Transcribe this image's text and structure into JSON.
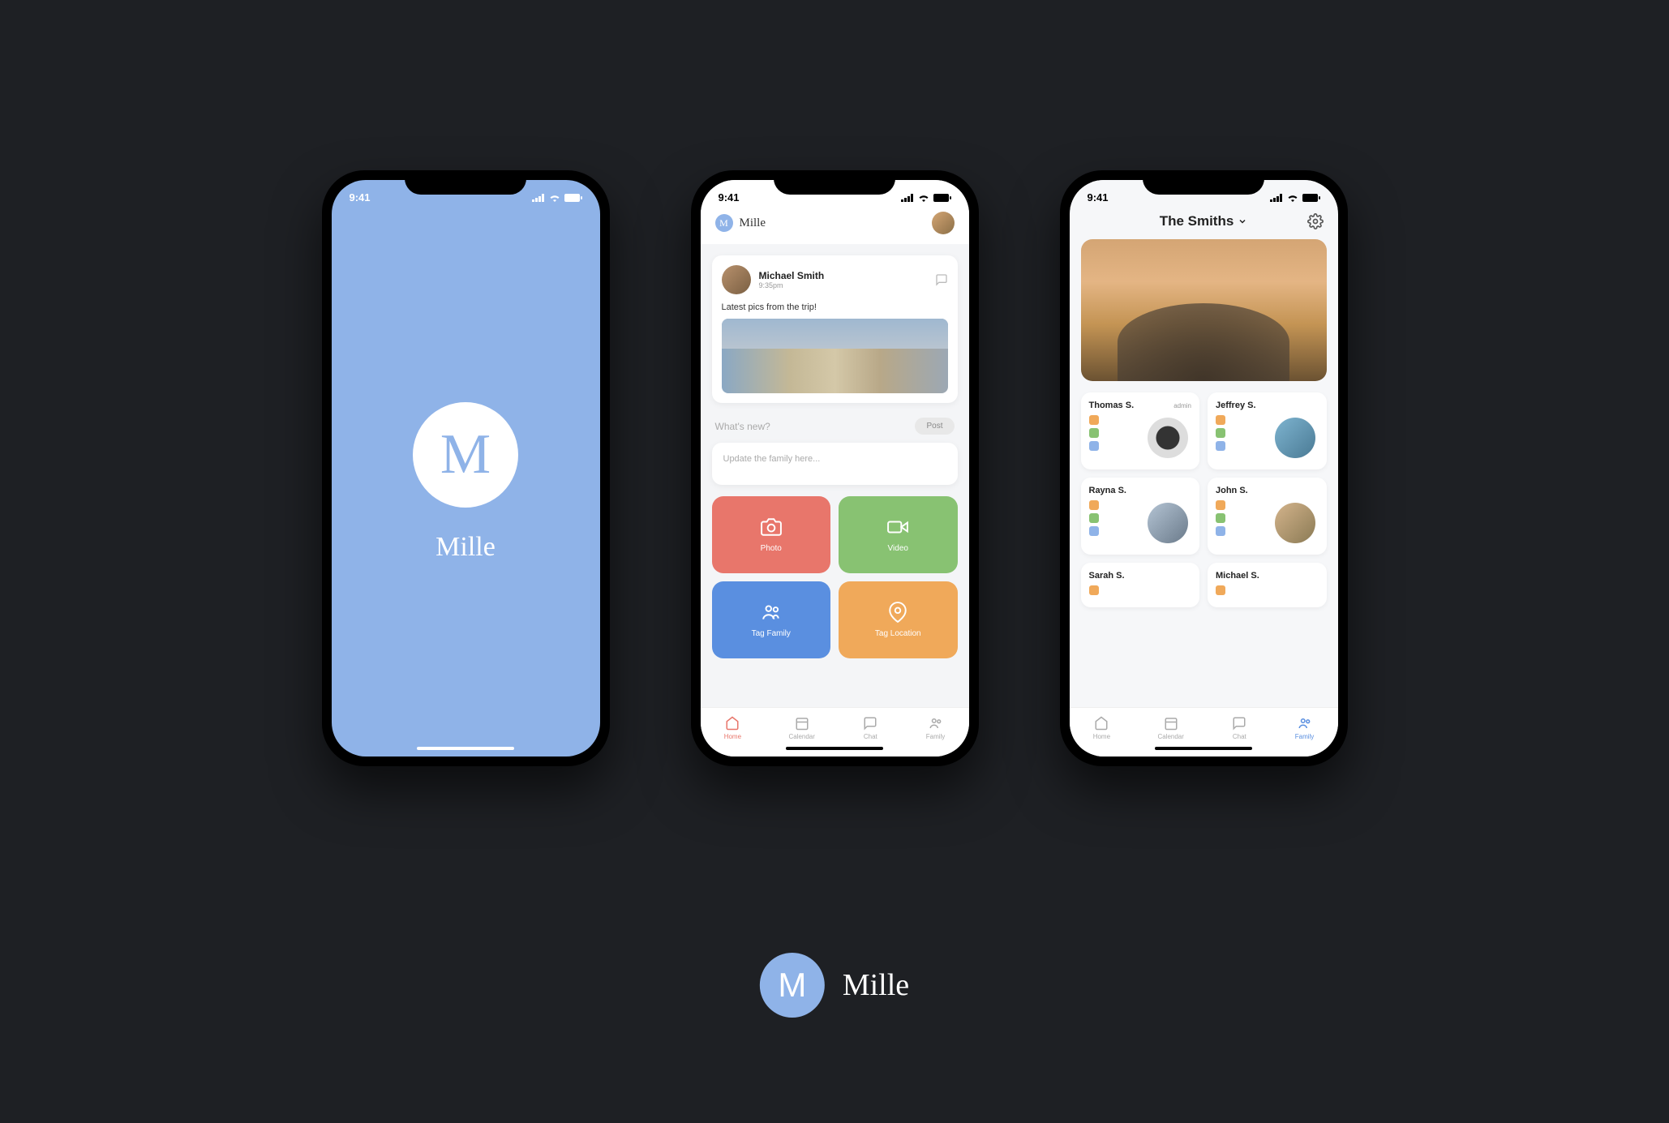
{
  "status_time": "9:41",
  "splash": {
    "logo_letter": "M",
    "title": "Mille"
  },
  "feed": {
    "header_title": "Mille",
    "post": {
      "author": "Michael Smith",
      "time": "9:35pm",
      "text": "Latest pics from the trip!"
    },
    "compose_prompt": "What's new?",
    "post_button": "Post",
    "compose_placeholder": "Update the family here...",
    "tiles": {
      "photo": "Photo",
      "video": "Video",
      "tag_family": "Tag Family",
      "tag_location": "Tag Location"
    },
    "tabs": {
      "home": "Home",
      "calendar": "Calendar",
      "chat": "Chat",
      "family": "Family"
    }
  },
  "family": {
    "title": "The Smiths",
    "members": [
      {
        "name": "Thomas S.",
        "badge": "admin"
      },
      {
        "name": "Jeffrey S."
      },
      {
        "name": "Rayna S."
      },
      {
        "name": "John S."
      },
      {
        "name": "Sarah S."
      },
      {
        "name": "Michael S."
      }
    ],
    "tabs": {
      "home": "Home",
      "calendar": "Calendar",
      "chat": "Chat",
      "family": "Family"
    }
  },
  "brand": {
    "logo_letter": "M",
    "name": "Mille"
  }
}
